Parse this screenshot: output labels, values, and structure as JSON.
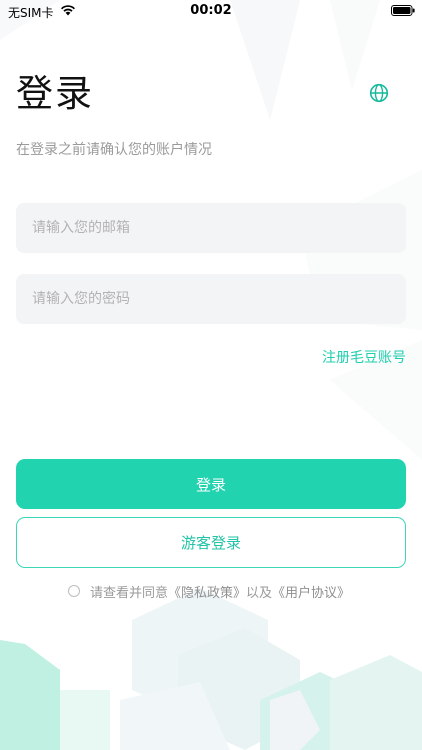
{
  "status_bar": {
    "carrier": "无SIM卡",
    "time": "00:02",
    "icons": [
      "wifi-icon",
      "battery-icon"
    ]
  },
  "header": {
    "title": "登录",
    "subtitle": "在登录之前请确认您的账户情况",
    "language_icon": "globe-icon"
  },
  "form": {
    "email_placeholder": "请输入您的邮箱",
    "password_placeholder": "请输入您的密码",
    "email_value": "",
    "password_value": ""
  },
  "links": {
    "register": "注册毛豆账号"
  },
  "buttons": {
    "login": "登录",
    "guest": "游客登录"
  },
  "agreement": {
    "checked": false,
    "text_prefix": "请查看并同意",
    "privacy_policy": "《隐私政策》",
    "conjunction": "以及",
    "user_agreement": "《用户协议》"
  },
  "colors": {
    "accent": "#22d3b0",
    "accent_text": "#22c3a6",
    "field_bg": "#f3f4f6",
    "subtle_text": "#9b9b9b"
  }
}
